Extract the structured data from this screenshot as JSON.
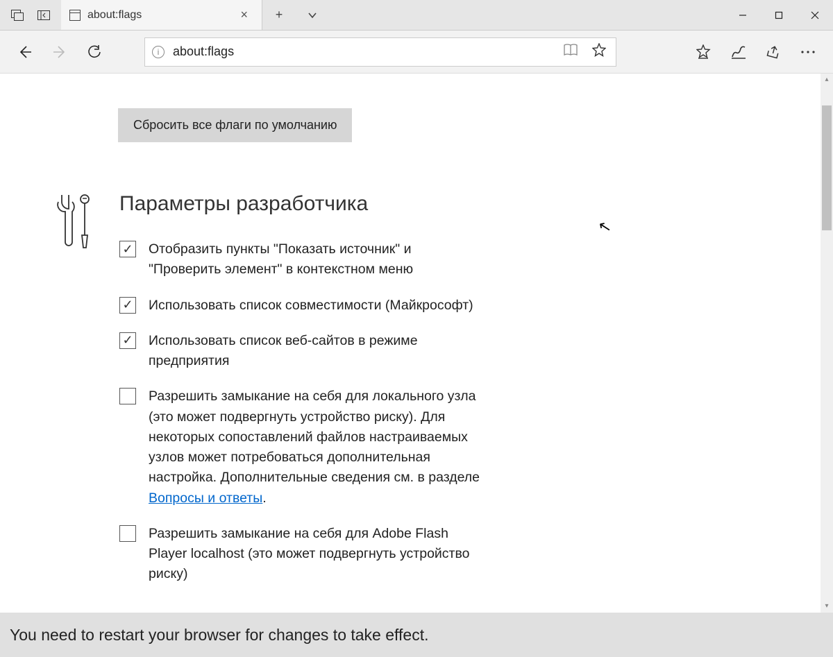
{
  "tab": {
    "title": "about:flags"
  },
  "address": {
    "value": "about:flags"
  },
  "page": {
    "reset_label": "Сбросить все флаги по умолчанию",
    "section_title": "Параметры разработчика",
    "options": [
      {
        "checked": true,
        "label": "Отобразить пункты \"Показать источник\" и \"Проверить элемент\" в контекстном меню"
      },
      {
        "checked": true,
        "label": "Использовать список совместимости (Майкрософт)"
      },
      {
        "checked": true,
        "label": "Использовать список веб-сайтов в режиме предприятия"
      },
      {
        "checked": false,
        "label": "Разрешить замыкание на себя для локального узла (это может подвергнуть устройство риску). Для некоторых сопоставлений файлов настраиваемых узлов может потребоваться дополнительная настройка. Дополнительные сведения см. в разделе ",
        "link": "Вопросы и ответы",
        "suffix": "."
      },
      {
        "checked": false,
        "label": "Разрешить замыкание на себя для Adobe Flash Player localhost (это может подвергнуть устройство риску)"
      }
    ]
  },
  "bottombar": {
    "message": "You need to restart your browser for changes to take effect."
  }
}
